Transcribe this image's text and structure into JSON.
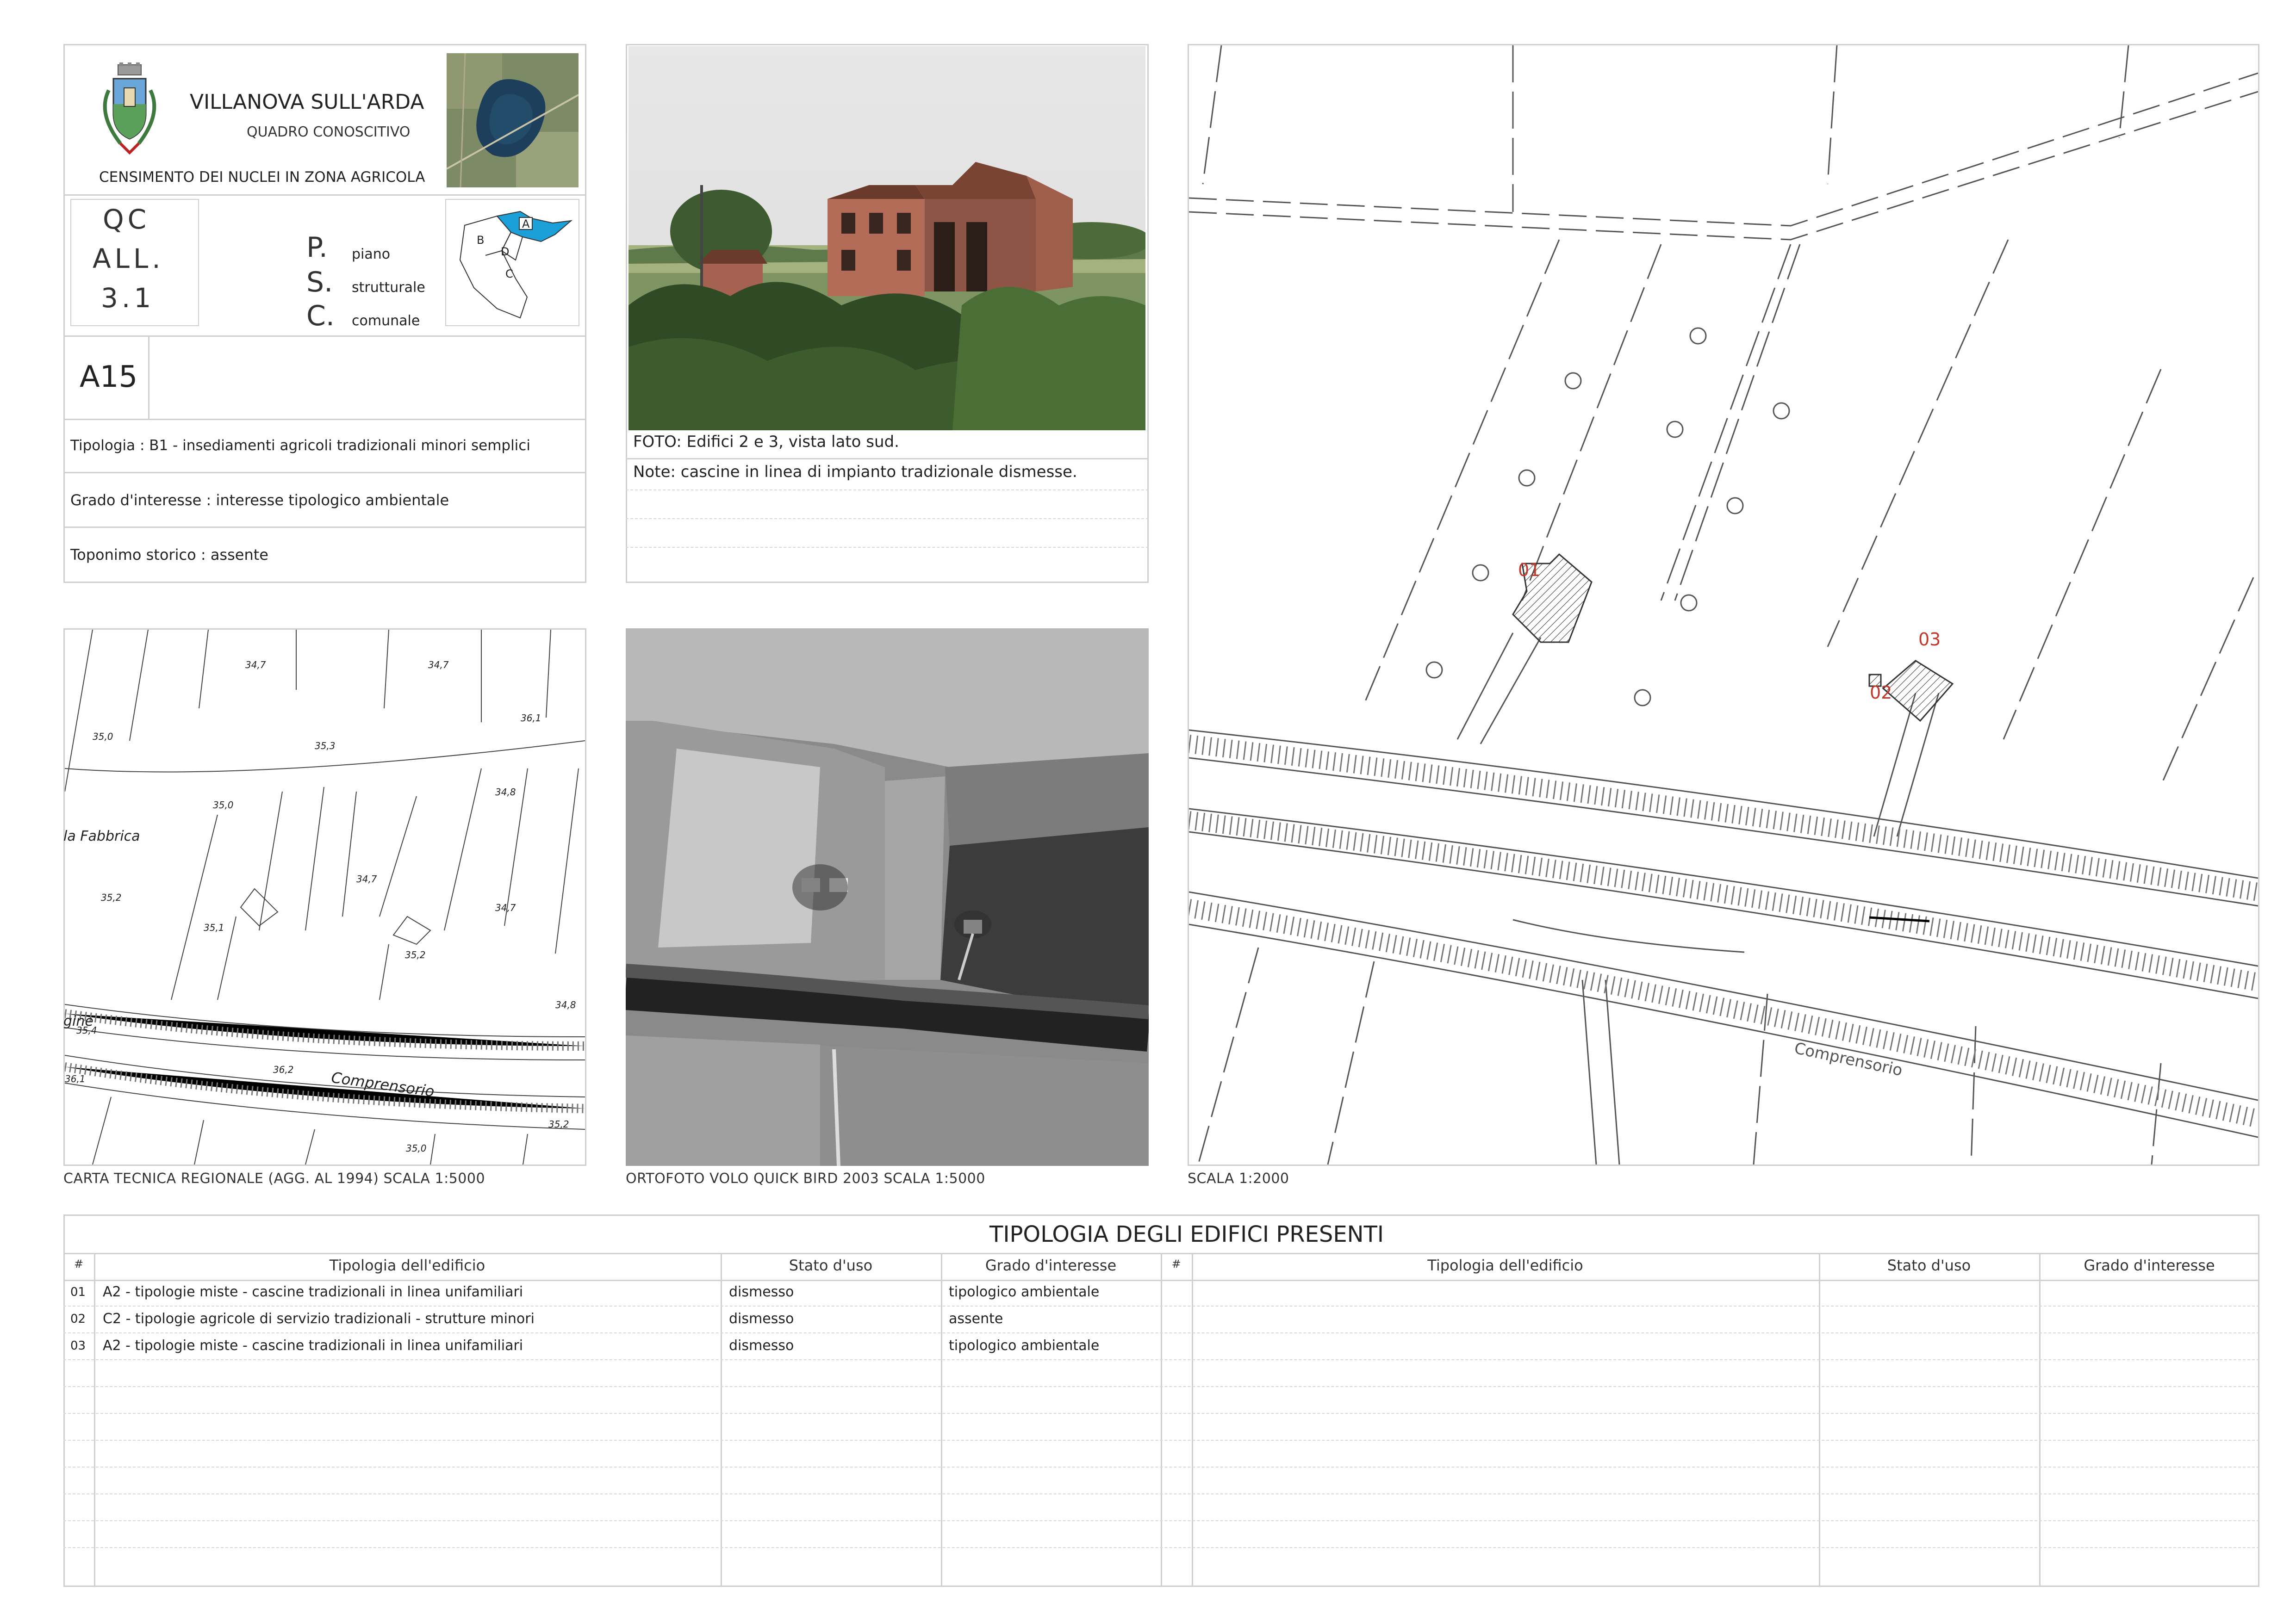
{
  "header": {
    "municipality": "VILLANOVA SULL'ARDA",
    "subtitle": "QUADRO CONOSCITIVO",
    "census_title": "CENSIMENTO DEI NUCLEI IN ZONA AGRICOLA",
    "qc_lines": [
      "QC",
      "ALL.",
      "3.1"
    ],
    "psc_letters": [
      "P.",
      "S.",
      "C."
    ],
    "psc_words": [
      "piano",
      "strutturale",
      "comunale"
    ],
    "zone_labels": [
      "A",
      "B",
      "C",
      "D"
    ],
    "code": "A15"
  },
  "info": {
    "tipologia": "Tipologia : B1 - insediamenti agricoli tradizionali minori semplici",
    "grado": "Grado d'interesse : interesse tipologico ambientale",
    "toponimo": "Toponimo storico : assente"
  },
  "photo": {
    "caption": "FOTO: Edifici 2 e 3, vista lato sud.",
    "note": "Note: cascine in linea di impianto tradizionale dismesse."
  },
  "maps": {
    "ctr_caption": "CARTA TECNICA REGIONALE (AGG. AL 1994) SCALA 1:5000",
    "ortho_caption": "ORTOFOTO VOLO QUICK BIRD 2003 SCALA 1:5000",
    "plan_caption": "SCALA 1:2000",
    "ctr_labels": [
      "34,7",
      "34,7",
      "35,0",
      "36,1",
      "35,3",
      "35,0",
      "34,8",
      "la Fabbrica",
      "35,2",
      "34,7",
      "34,7",
      "35,1",
      "35,2",
      "34,8",
      "gine",
      "35,4",
      "36,2",
      "Comprensorio",
      "36,1",
      "35,0",
      "35,2"
    ],
    "plan_labels": [
      "01",
      "02",
      "03",
      "Comprensorio"
    ]
  },
  "table": {
    "title": "TIPOLOGIA DEGLI EDIFICI PRESENTI",
    "headers": [
      "#",
      "Tipologia dell'edificio",
      "Stato d'uso",
      "Grado d'interesse"
    ],
    "rows": [
      {
        "n": "01",
        "tipologia": "A2 - tipologie miste - cascine tradizionali in linea unifamiliari",
        "stato": "dismesso",
        "grado": "tipologico ambientale"
      },
      {
        "n": "02",
        "tipologia": "C2 - tipologie agricole di servizio tradizionali - strutture minori",
        "stato": "dismesso",
        "grado": "assente"
      },
      {
        "n": "03",
        "tipologia": "A2 - tipologie miste - cascine tradizionali in linea unifamiliari",
        "stato": "dismesso",
        "grado": "tipologico ambientale"
      }
    ]
  },
  "colors": {
    "accent_blue": "#1a9fd8",
    "label_red": "#c0392b",
    "border": "#cfcfcf"
  }
}
